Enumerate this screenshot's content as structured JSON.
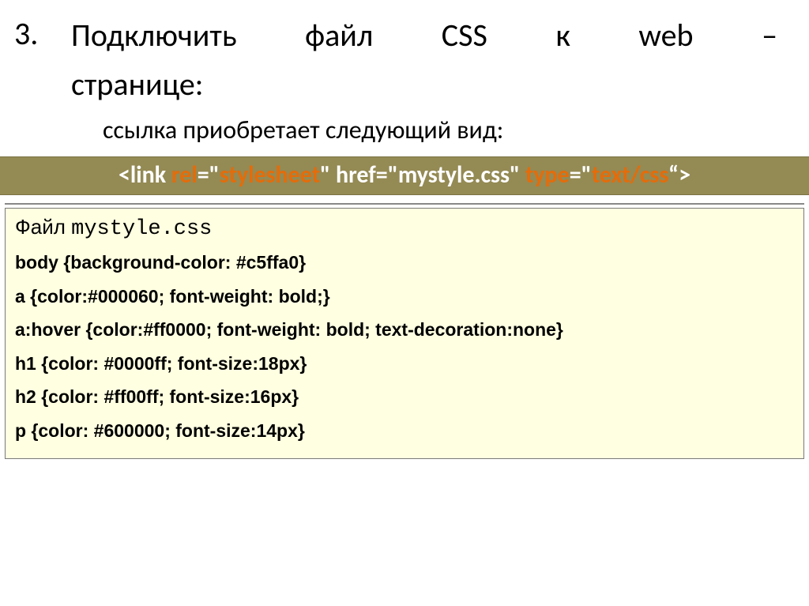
{
  "list_number": "3.",
  "heading_line1": "Подключить файл CSS к web –",
  "heading_line2": "странице:",
  "subtext": "ссылка приобретает следующий вид:",
  "link_tag": {
    "p1": "<link ",
    "rel_key": "rel",
    "p2": "=\"",
    "rel_val": "stylesheet",
    "p3": "\" href=\"mystyle.css\" ",
    "type_key": "type",
    "p4": "=\"",
    "type_val": "text/css",
    "p5": "“>"
  },
  "file_label": "Файл ",
  "file_name": "mystyle.css",
  "css_lines": [
    "body {background-color: #c5ffa0}",
    "a {color:#000060; font-weight: bold;}",
    "a:hover {color:#ff0000; font-weight: bold; text-decoration:none}",
    "h1 {color: #0000ff; font-size:18px}",
    "h2 {color: #ff00ff; font-size:16px}",
    "p {color: #600000; font-size:14px}"
  ]
}
